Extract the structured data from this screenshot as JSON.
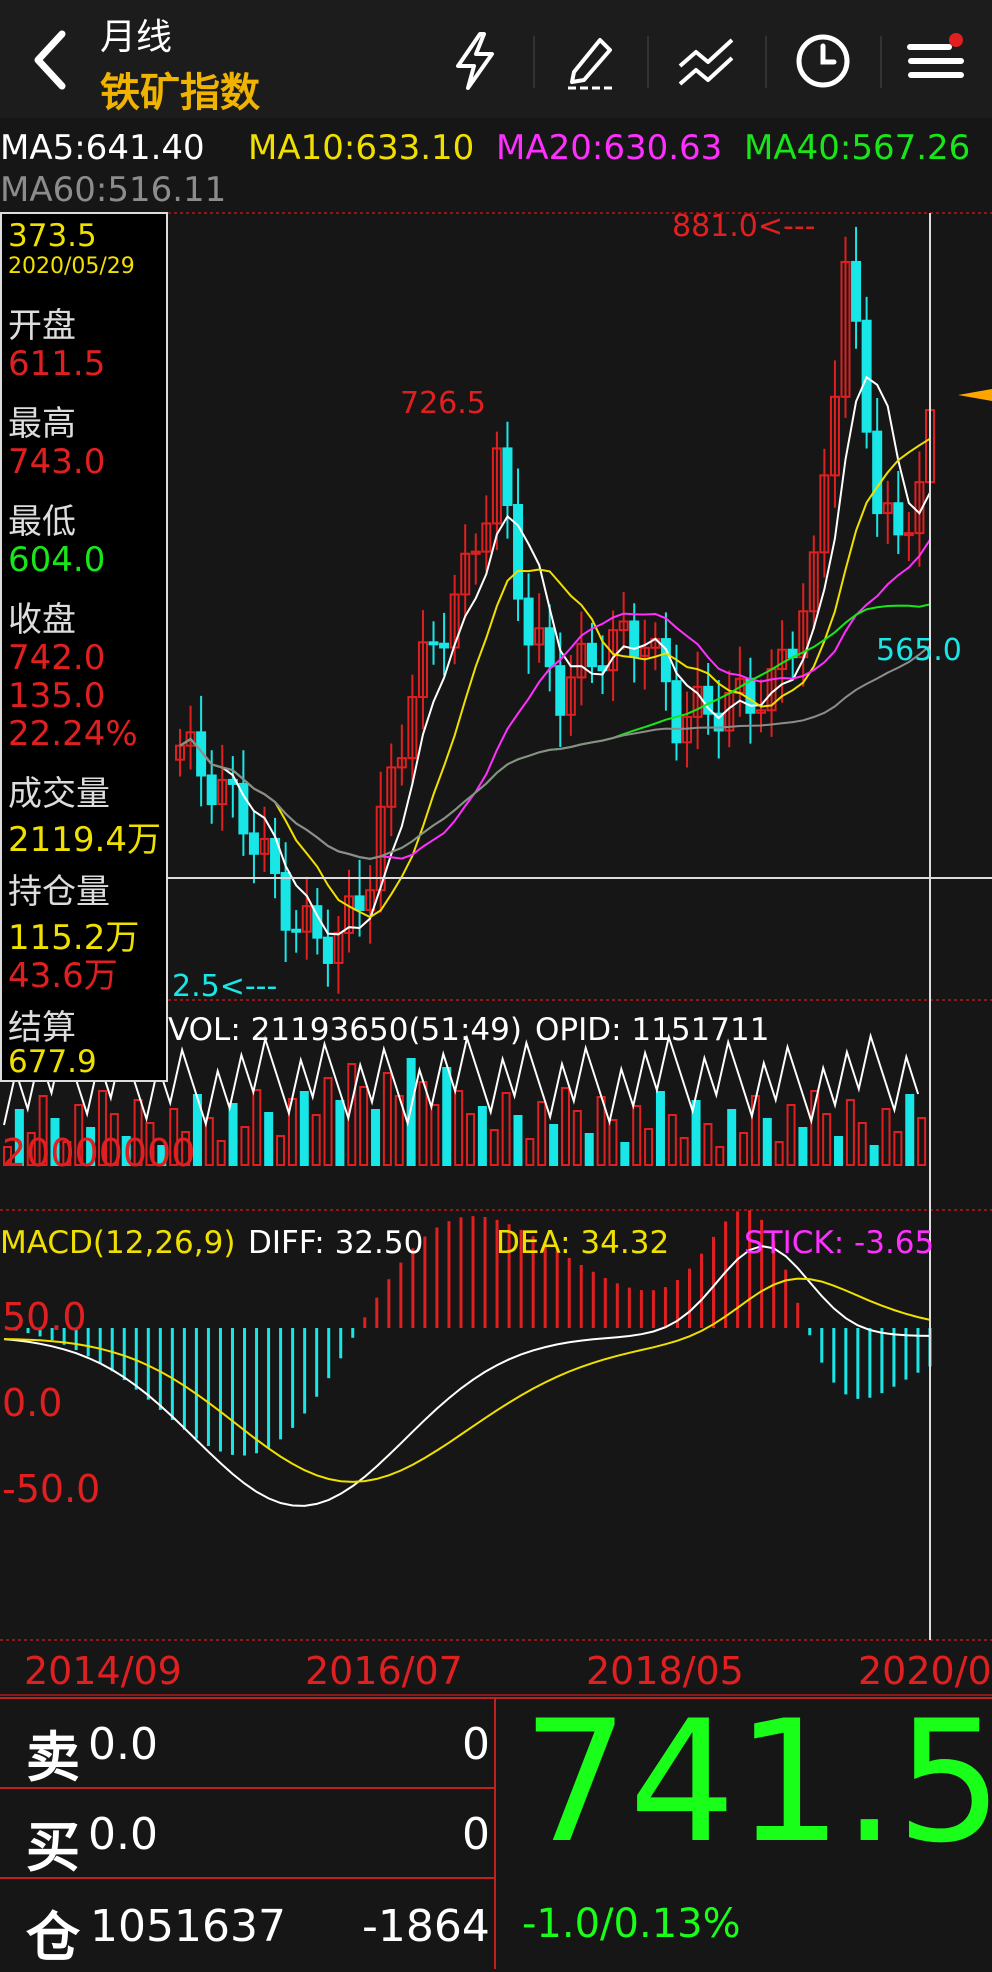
{
  "header": {
    "period": "月线",
    "instrument": "铁矿指数",
    "icons": [
      "back-icon",
      "lightning-icon",
      "pen-icon",
      "trend-line-icon",
      "clock-icon",
      "menu-icon"
    ]
  },
  "ma_legend": [
    {
      "label": "MA5:641.40",
      "color": "#ffffff"
    },
    {
      "label": "MA10:633.10",
      "color": "#f0e000"
    },
    {
      "label": "MA20:630.63",
      "color": "#ff30ff"
    },
    {
      "label": "MA40:567.26",
      "color": "#19e619"
    },
    {
      "label": "MA60:516.11",
      "color": "#8c8c8c"
    }
  ],
  "info": {
    "price": "373.5",
    "date": "2020/05/29",
    "open_label": "开盘",
    "open": "611.5",
    "high_label": "最高",
    "high": "743.0",
    "low_label": "最低",
    "low": "604.0",
    "close_label": "收盘",
    "close": "742.0",
    "change": "135.0",
    "change_pct": "22.24%",
    "volume_label": "成交量",
    "volume": "2119.4万",
    "oi_label": "持仓量",
    "oi": "115.2万",
    "oi_change": "43.6万",
    "settle_label": "结算",
    "settle": "677.9"
  },
  "price_annotations": {
    "high_marker": "881.0<---",
    "peak_label": "726.5",
    "low_marker": "565.0",
    "min_marker": "2.5<---"
  },
  "volume_legend": {
    "vol": "VOL: 21193650(51:49)",
    "opid": "OPID: 1151711",
    "axis_label": "20000000"
  },
  "macd_legend": {
    "name": "MACD(12,26,9)",
    "diff": "DIFF: 32.50",
    "dea": "DEA: 34.32",
    "stick": "STICK: -3.65",
    "ticks": [
      "50.0",
      "0.0",
      "-50.0"
    ]
  },
  "x_axis": [
    "2014/09",
    "2016/07",
    "2018/05",
    "2020/0"
  ],
  "bottom": {
    "sell_glyph": "卖",
    "sell_price": "0.0",
    "sell_qty": "0",
    "buy_glyph": "买",
    "buy_price": "0.0",
    "buy_qty": "0",
    "oi_glyph": "仓",
    "oi_value": "1051637",
    "oi_delta": "-1864",
    "last_price": "741.5",
    "last_change": "-1.0/0.13%"
  },
  "colors": {
    "up": "#e02020",
    "down": "#19e6e6",
    "ma5": "#ffffff",
    "ma10": "#f0e000",
    "ma20": "#ff30ff",
    "ma40": "#19e619",
    "ma60": "#8c8c8c",
    "price_big": "#19ff19",
    "header_accent": "#f0b400"
  }
}
